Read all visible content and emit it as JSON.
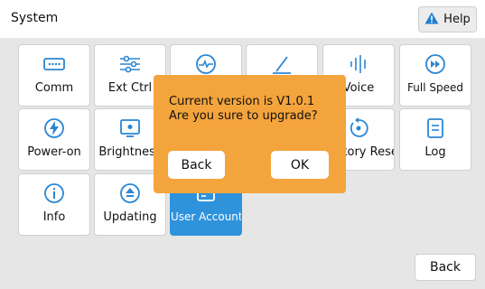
{
  "header": {
    "title": "System",
    "help_label": "Help",
    "help_icon": "warning-triangle-icon"
  },
  "tiles": [
    {
      "label": "Comm",
      "icon": "keyboard-icon"
    },
    {
      "label": "Ext Ctrl",
      "icon": "sliders-icon"
    },
    {
      "label": "",
      "icon": "pulse-circle-icon"
    },
    {
      "label": "",
      "icon": "pen-icon"
    },
    {
      "label": "Voice",
      "icon": "sound-wave-icon"
    },
    {
      "label": "Full Speed",
      "icon": "fast-forward-circle-icon"
    },
    {
      "label": "Power-on",
      "icon": "power-bolt-icon"
    },
    {
      "label": "Brightness",
      "icon": "brightness-icon"
    },
    {
      "label": "Factory Reset",
      "icon": "reset-icon"
    },
    {
      "label": "Log",
      "icon": "document-icon"
    },
    {
      "label": "Info",
      "icon": "info-icon"
    },
    {
      "label": "Updating",
      "icon": "upload-circle-icon"
    },
    {
      "label": "User Account",
      "icon": "user-account-icon"
    }
  ],
  "footer": {
    "back_label": "Back"
  },
  "dialog": {
    "line1": "Current version is V1.0.1",
    "line2": "Are you sure to upgrade?",
    "back_label": "Back",
    "ok_label": "OK"
  },
  "colors": {
    "accent": "#2f93dc",
    "dialog_bg": "#f4a43c",
    "warning": "#1f7fd0"
  }
}
